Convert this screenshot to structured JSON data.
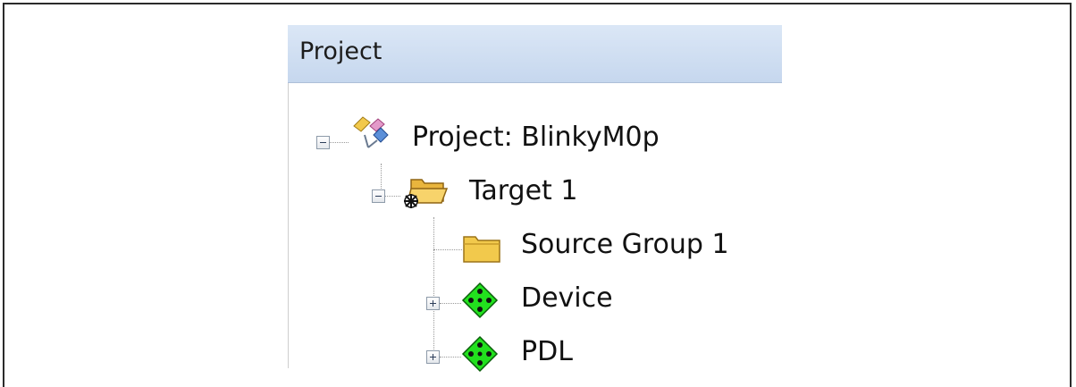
{
  "panel": {
    "title": "Project"
  },
  "tree": {
    "project": {
      "label": "Project: BlinkyM0p",
      "icon": "project-icon",
      "expanded": true
    },
    "target": {
      "label": "Target 1",
      "icon": "target-folder-icon",
      "expanded": true
    },
    "source_group": {
      "label": "Source Group 1",
      "icon": "folder-icon"
    },
    "device": {
      "label": "Device",
      "icon": "component-icon",
      "expanded": false
    },
    "pdl": {
      "label": "PDL",
      "icon": "component-icon",
      "expanded": false
    }
  },
  "colors": {
    "header_top": "#dbe7f6",
    "header_bottom": "#c6d7ee",
    "component_green": "#22e01e",
    "folder_yellow": "#f2c94c"
  }
}
